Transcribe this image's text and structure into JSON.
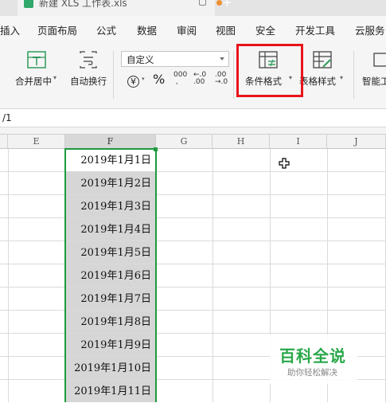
{
  "titlebar": {
    "doc_title": "新建 XLS 工作表.xls",
    "new_tab": "+"
  },
  "menu": [
    "插入",
    "页面布局",
    "公式",
    "数据",
    "审阅",
    "视图",
    "安全",
    "开发工具",
    "云服务"
  ],
  "ribbon": {
    "merge_center": "合并居中",
    "wrap_text": "自动换行",
    "number_format": "自定义",
    "currency_symbol": "¥",
    "percent_symbol": "%",
    "thousands": "000",
    "increase_decimal": ".0 .00",
    "decrease_decimal": ".00 .0",
    "conditional_format": "条件格式",
    "table_style": "表格样式",
    "smart_tool": "智能工"
  },
  "formula_bar": {
    "content": "/1"
  },
  "columns": [
    "E",
    "F",
    "G",
    "H",
    "I",
    "J"
  ],
  "selected_column": "F",
  "cells_F": [
    "2019年1月1日",
    "2019年1月2日",
    "2019年1月3日",
    "2019年1月4日",
    "2019年1月5日",
    "2019年1月6日",
    "2019年1月7日",
    "2019年1月8日",
    "2019年1月9日",
    "2019年1月10日",
    "2019年1月11日"
  ],
  "watermark": {
    "title": "百科全说",
    "subtitle": "助你轻松解决"
  },
  "colors": {
    "selection": "#1d9a3e",
    "highlight": "#e8141c",
    "watermark": "#2aa84a"
  }
}
